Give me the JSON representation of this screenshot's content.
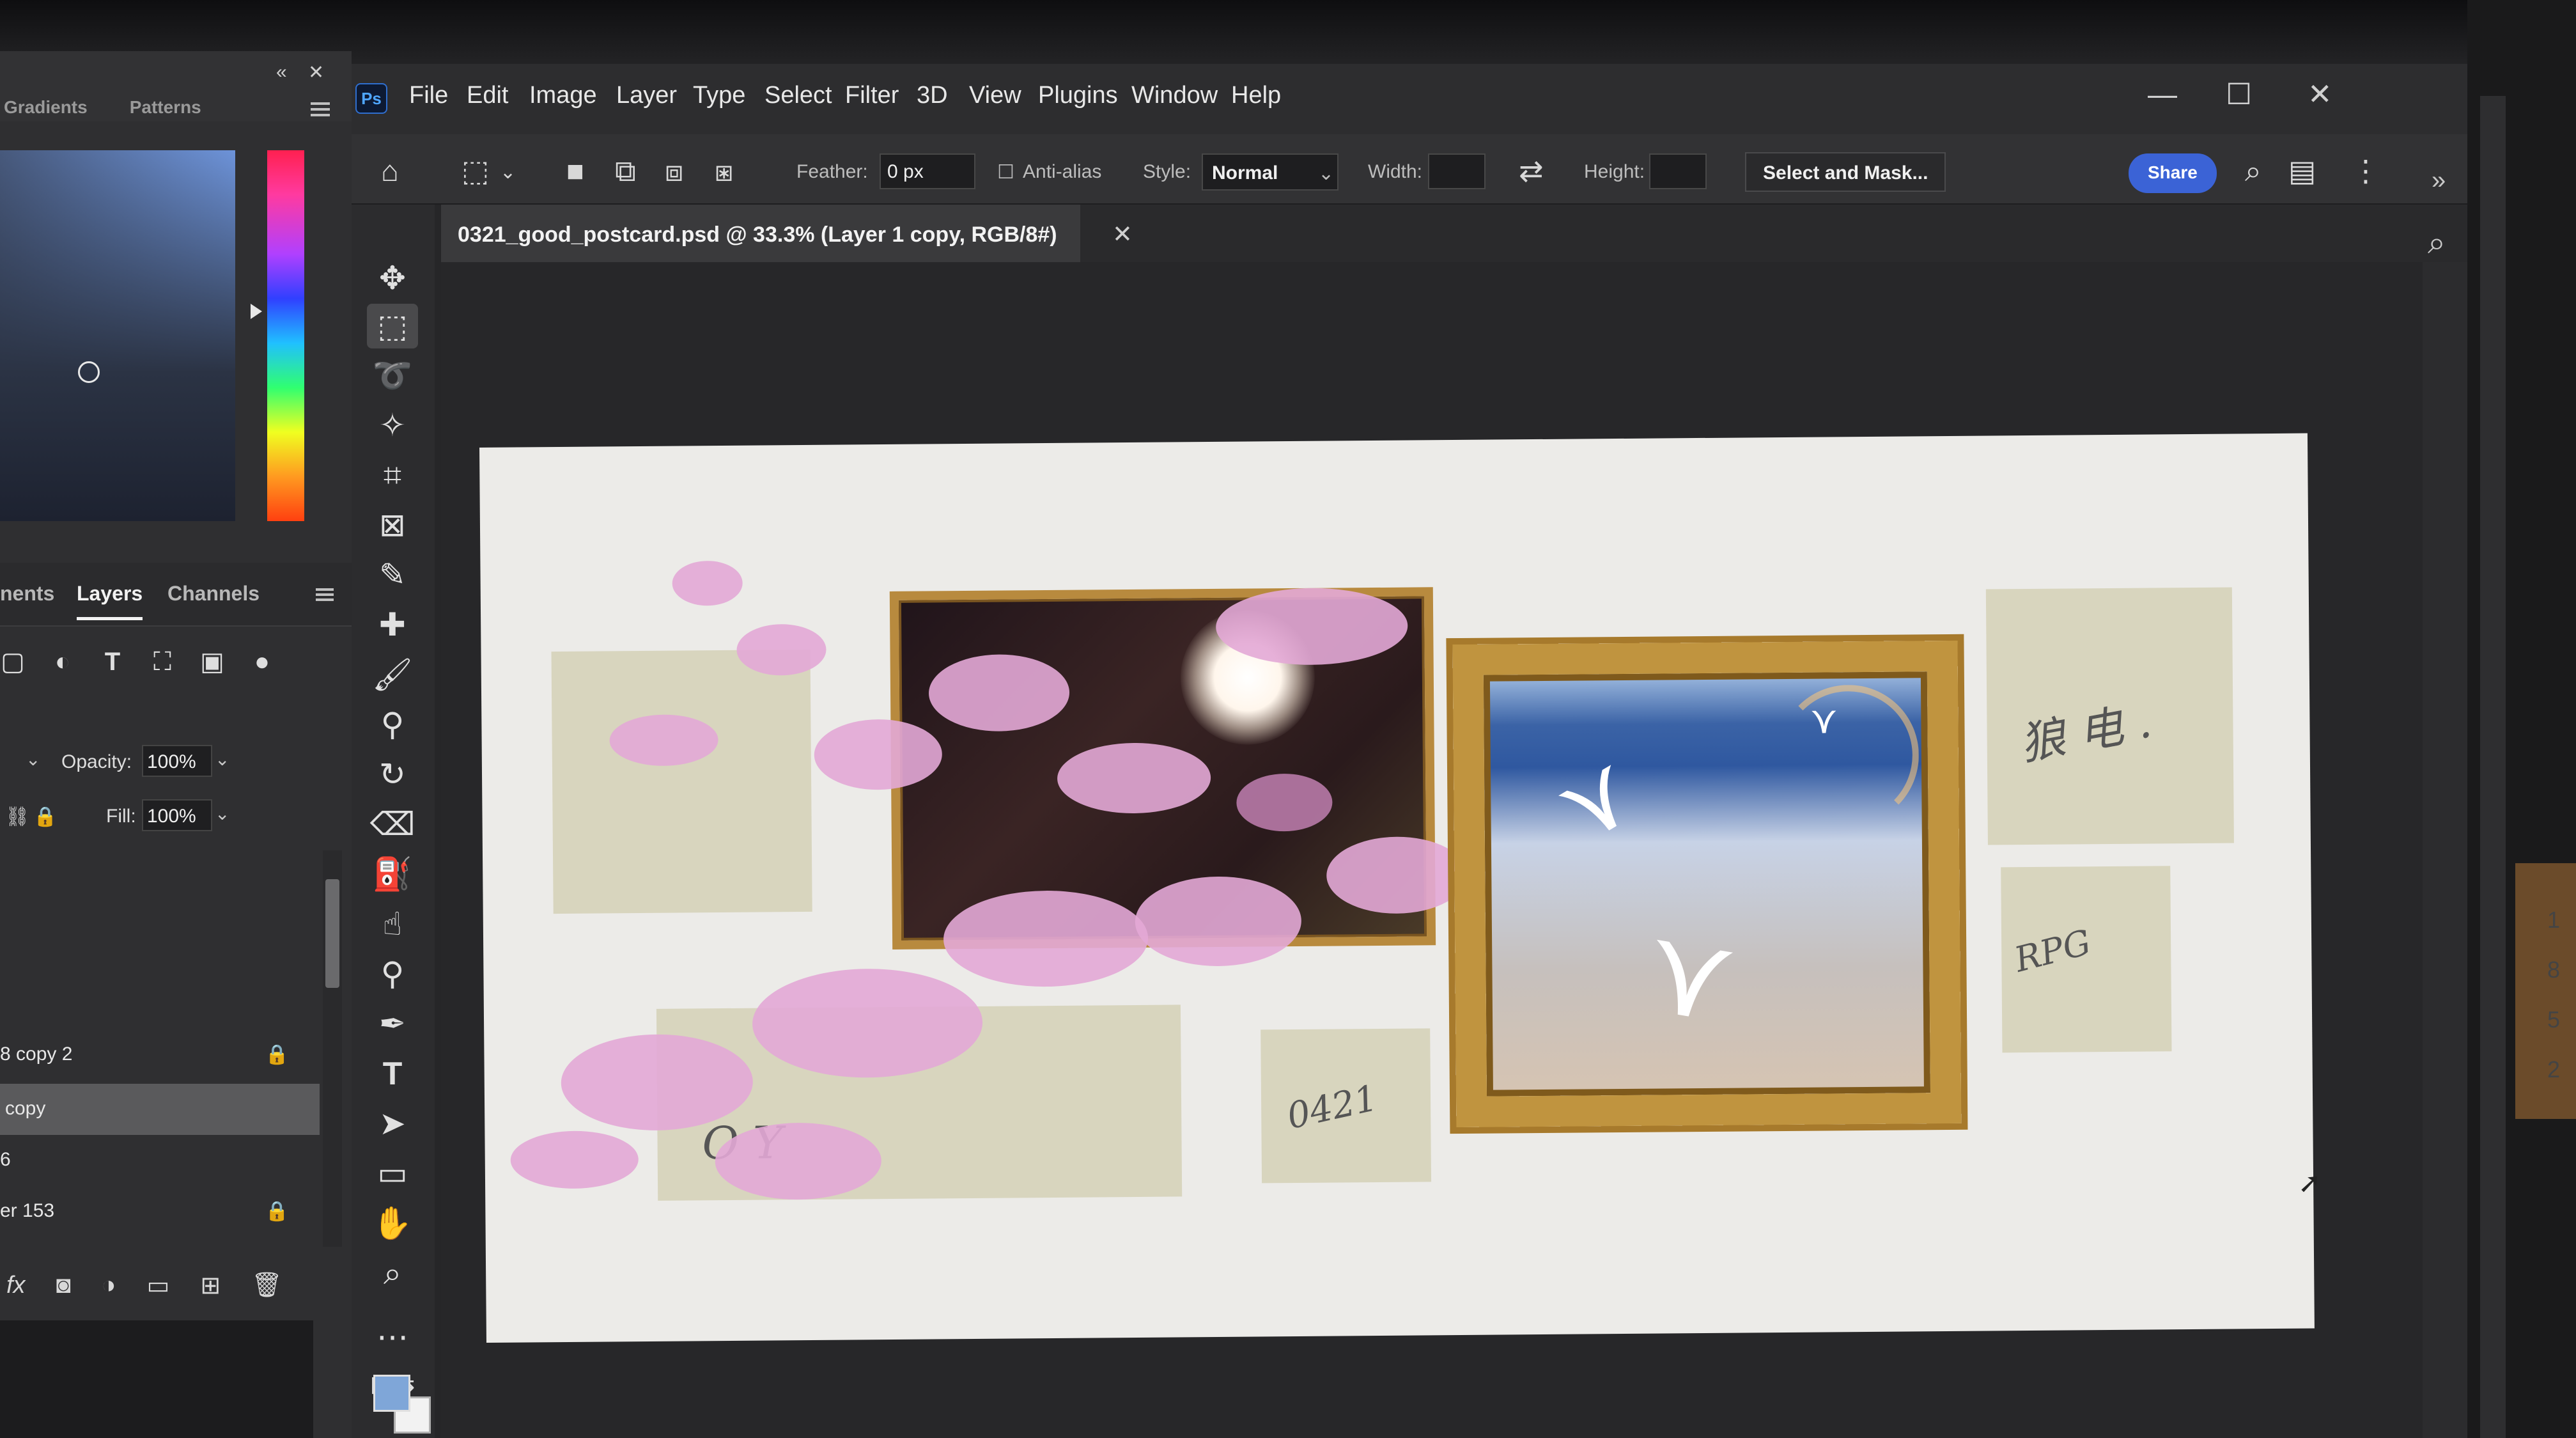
{
  "left_panel": {
    "top_tabs": [
      "Gradients",
      "Patterns"
    ],
    "layers_tabs": [
      "nents",
      "Layers",
      "Channels"
    ],
    "opacity_label": "Opacity:",
    "opacity_value": "100%",
    "fill_label": "Fill:",
    "fill_value": "100%",
    "layers": [
      "8 copy 2",
      "copy",
      "6",
      "er 153"
    ]
  },
  "menubar": {
    "items": [
      "File",
      "Edit",
      "Image",
      "Layer",
      "Type",
      "Select",
      "Filter",
      "3D",
      "View",
      "Plugins",
      "Window",
      "Help"
    ]
  },
  "options": {
    "feather_label": "Feather:",
    "feather_value": "0 px",
    "antialias_label": "Anti-alias",
    "style_label": "Style:",
    "style_value": "Normal",
    "width_label": "Width:",
    "height_label": "Height:",
    "select_mask_label": "Select and Mask...",
    "share_label": "Share"
  },
  "document": {
    "tab_title": "0321_good_postcard.psd @ 33.3% (Layer 1 copy, RGB/8#)"
  },
  "canvas": {
    "note_left": "O Y",
    "note_mid": "0421",
    "note_right_top": "狼 电 .",
    "note_right_bottom": "RPG"
  },
  "edge": {
    "numbers": [
      "1",
      "8",
      "5",
      "2"
    ]
  },
  "colors": {
    "share_button": "#3b63d6",
    "foreground_swatch": "#7fa6d8",
    "frame_gold": "#c0943f",
    "blossom": "#e3a9d6"
  }
}
